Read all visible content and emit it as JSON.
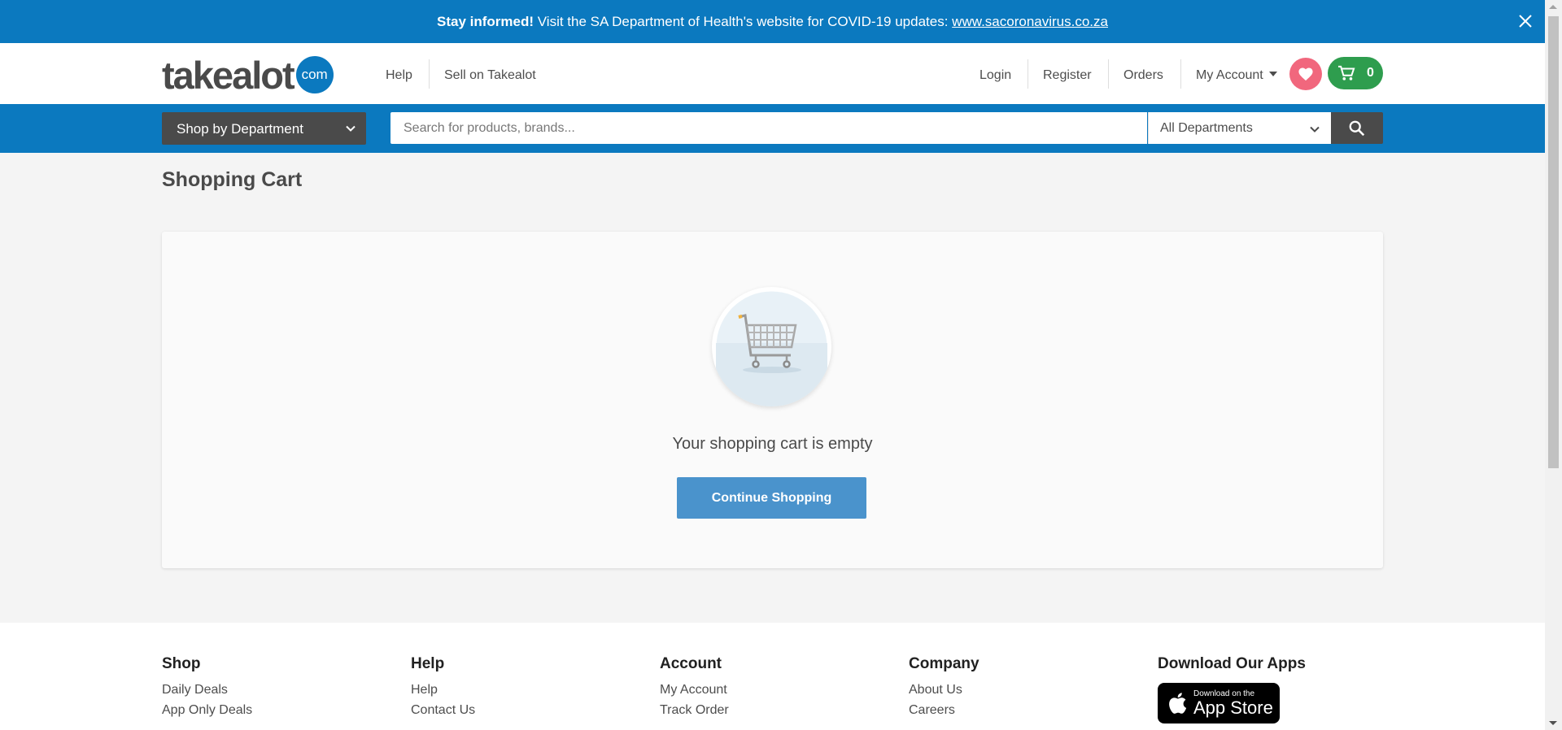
{
  "notice": {
    "bold": "Stay informed!",
    "text": " Visit the SA Department of Health's website for COVID-19 updates: ",
    "link": "www.sacoronavirus.co.za"
  },
  "header": {
    "logo_word": "takealot",
    "logo_badge": "com",
    "nav_left": [
      "Help",
      "Sell on Takealot"
    ],
    "nav_right": [
      "Login",
      "Register",
      "Orders"
    ],
    "account_label": "My Account",
    "cart_count": "0"
  },
  "search": {
    "department_button": "Shop by Department",
    "placeholder": "Search for products, brands...",
    "category_selected": "All Departments"
  },
  "main": {
    "title": "Shopping Cart",
    "empty_message": "Your shopping cart is empty",
    "continue_button": "Continue Shopping"
  },
  "footer": {
    "columns": [
      {
        "heading": "Shop",
        "links": [
          "Daily Deals",
          "App Only Deals"
        ]
      },
      {
        "heading": "Help",
        "links": [
          "Help",
          "Contact Us"
        ]
      },
      {
        "heading": "Account",
        "links": [
          "My Account",
          "Track Order"
        ]
      },
      {
        "heading": "Company",
        "links": [
          "About Us",
          "Careers"
        ]
      }
    ],
    "apps_heading": "Download Our Apps",
    "appstore_small": "Download on the",
    "appstore_big": "App Store"
  },
  "colors": {
    "brand_blue": "#0b79bf",
    "button_blue": "#4a93cc",
    "wishlist_pink": "#f1677d",
    "cart_green": "#2e9d4e",
    "dark_gray": "#4a4a4a"
  },
  "icons": [
    "close-icon",
    "heart-icon",
    "cart-icon",
    "chevron-down-icon",
    "search-icon",
    "empty-cart-icon",
    "apple-icon"
  ]
}
